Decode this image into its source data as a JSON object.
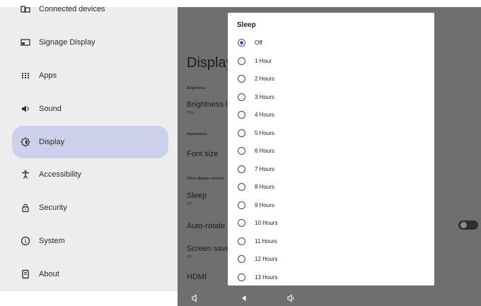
{
  "sidebar": {
    "items": [
      {
        "label": "Connected devices",
        "icon": "connected-devices-icon",
        "selected": false
      },
      {
        "label": "Signage Display",
        "icon": "signage-display-icon",
        "selected": false
      },
      {
        "label": "Apps",
        "icon": "apps-grid-icon",
        "selected": false
      },
      {
        "label": "Sound",
        "icon": "speaker-icon",
        "selected": false
      },
      {
        "label": "Display",
        "icon": "brightness-icon",
        "selected": true
      },
      {
        "label": "Accessibility",
        "icon": "accessibility-icon",
        "selected": false
      },
      {
        "label": "Security",
        "icon": "lock-icon",
        "selected": false
      },
      {
        "label": "System",
        "icon": "info-icon",
        "selected": false
      },
      {
        "label": "About",
        "icon": "device-icon",
        "selected": false
      }
    ]
  },
  "content": {
    "heading": "Display",
    "brightness_section": "Brightness",
    "brightness_title": "Brightness level",
    "brightness_value": "39%",
    "appearance_section": "Appearance",
    "font_size_title": "Font size",
    "other_section": "Other display controls",
    "sleep_title": "Sleep",
    "sleep_value": "Off",
    "autorotate_title": "Auto-rotate screen",
    "screensaver_title": "Screen saver",
    "screensaver_value": "Off",
    "hdmi_title": "HDMI",
    "autorotate_enabled": false
  },
  "dialog": {
    "title": "Sleep",
    "selected_index": 0,
    "options": [
      "Off",
      "1 Hour",
      "2 Hours",
      "3 Hours",
      "4 Hours",
      "5 Hours",
      "6 Hours",
      "7 Hours",
      "8 Hours",
      "9 Hours",
      "10 Hours",
      "11 Hours",
      "12 Hours",
      "13 Hours"
    ]
  },
  "navbar": {
    "buttons": [
      "volume-down-icon",
      "back-icon",
      "volume-up-icon"
    ]
  },
  "colors": {
    "sidebar_bg": "#ededed",
    "selected_bg": "#ccd0ea",
    "scrim": "#6f6f6f",
    "accent": "#3f51b5"
  }
}
